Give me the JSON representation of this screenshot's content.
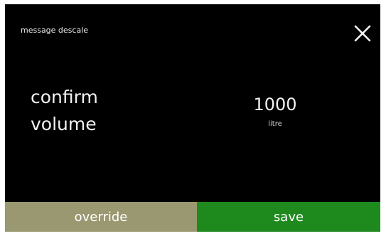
{
  "header": {
    "title": "message descale",
    "close_icon": "close-icon"
  },
  "prompt": {
    "line1": "confirm",
    "line2": "volume"
  },
  "reading": {
    "value": "1000",
    "unit": "litre"
  },
  "actions": {
    "override_label": "override",
    "save_label": "save"
  },
  "colors": {
    "background": "#000000",
    "text": "#f2f2f2",
    "override_button": "#9a9870",
    "save_button": "#1e8a1e"
  }
}
